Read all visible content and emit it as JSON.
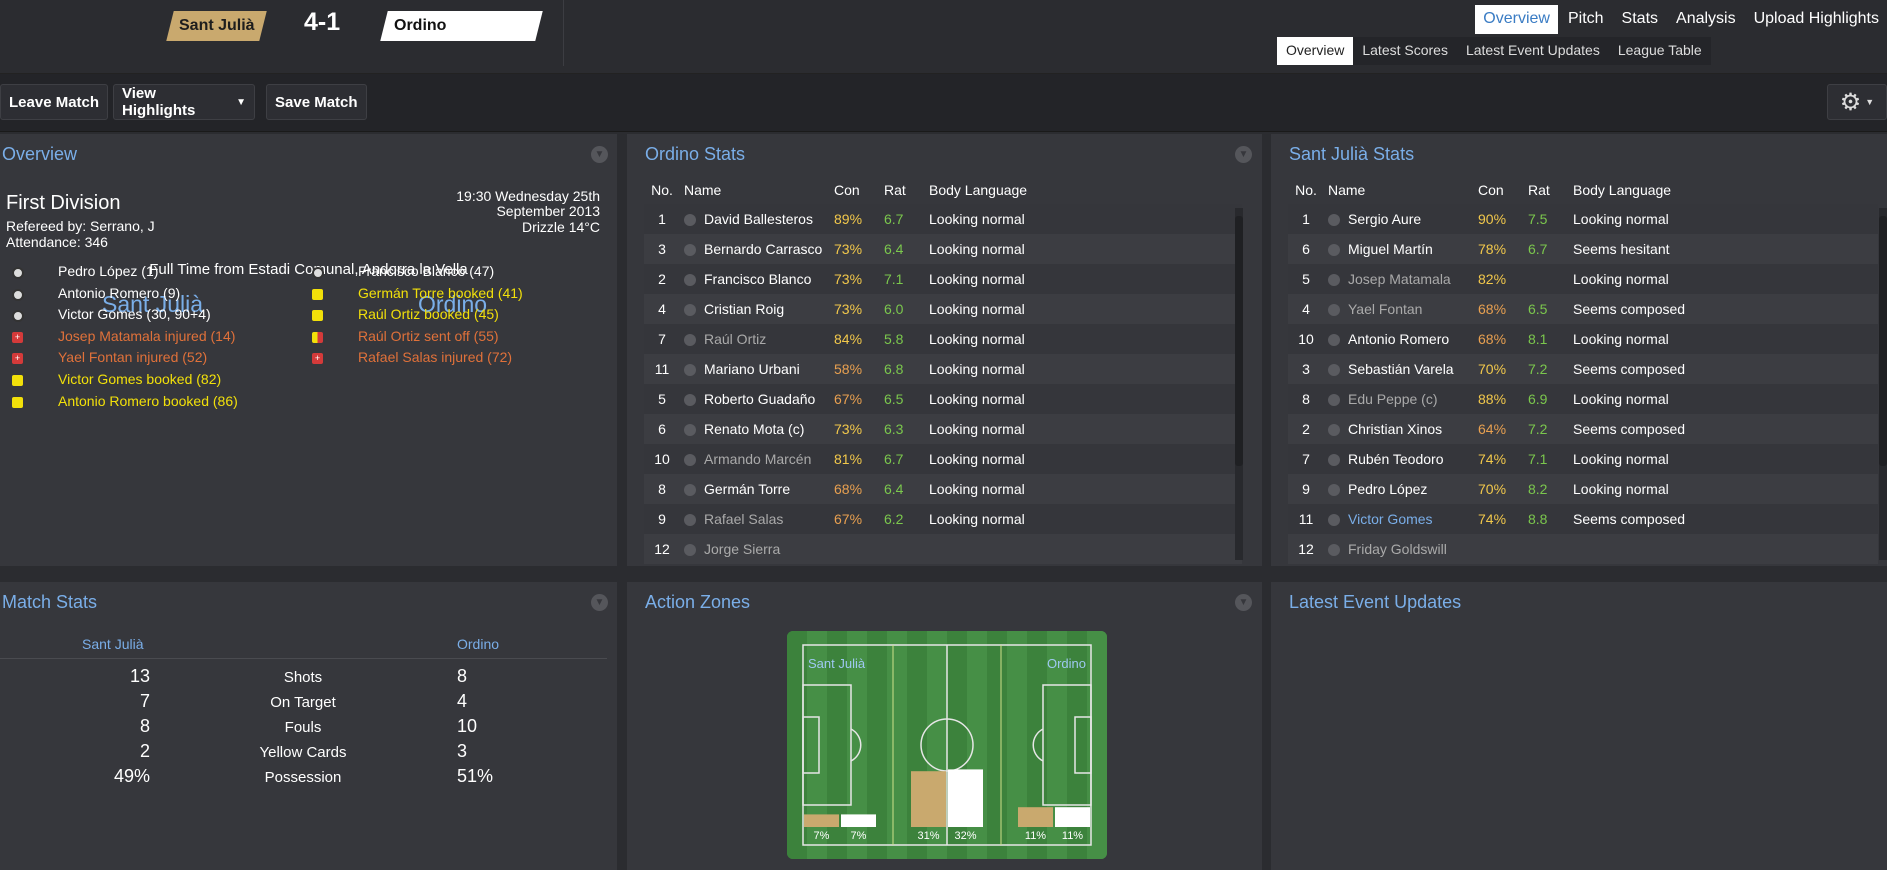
{
  "header": {
    "home": "Sant Julià",
    "score": "4-1",
    "away": "Ordino"
  },
  "nav": {
    "tabs": [
      "Overview",
      "Pitch",
      "Stats",
      "Analysis",
      "Upload Highlights"
    ],
    "subtabs": [
      "Overview",
      "Latest Scores",
      "Latest Event Updates",
      "League Table"
    ]
  },
  "toolbar": {
    "leave": "Leave Match",
    "highlights": "View Highlights",
    "save": "Save Match"
  },
  "overview": {
    "title": "Overview",
    "competition": "First Division",
    "referee": "Refereed by: Serrano, J",
    "attendance": "Attendance: 346",
    "datetime": "19:30 Wednesday 25th September 2013",
    "weather": "Drizzle 14°C",
    "status": "Full Time from Estadi Comunal, Andorra la Vella",
    "home": "Sant Julià",
    "away": "Ordino",
    "home_events": [
      {
        "t": "Pedro López (1)",
        "k": "goal"
      },
      {
        "t": "Antonio Romero (9)",
        "k": "goal"
      },
      {
        "t": "Victor Gomes (30, 90+4)",
        "k": "goal"
      },
      {
        "t": "Josep Matamala injured (14)",
        "k": "injury"
      },
      {
        "t": "Yael Fontan injured (52)",
        "k": "injury"
      },
      {
        "t": "Victor Gomes booked (82)",
        "k": "yellow"
      },
      {
        "t": "Antonio Romero booked (86)",
        "k": "yellow"
      }
    ],
    "away_events": [
      {
        "t": "Francisco Blanco (47)",
        "k": "goal"
      },
      {
        "t": "Germán Torre booked (41)",
        "k": "yellow"
      },
      {
        "t": "Raúl Ortiz booked (45)",
        "k": "yellow"
      },
      {
        "t": "Raúl Ortiz sent off (55)",
        "k": "red"
      },
      {
        "t": "Rafael Salas injured (72)",
        "k": "injury"
      }
    ]
  },
  "ordino": {
    "title": "Ordino Stats",
    "cols": [
      "No.",
      "Name",
      "Con",
      "Rat",
      "Body Language"
    ],
    "rows": [
      [
        "1",
        "David Ballesteros",
        "89%",
        "6.7",
        "Looking normal"
      ],
      [
        "3",
        "Bernardo Carrasco",
        "73%",
        "6.4",
        "Looking normal"
      ],
      [
        "2",
        "Francisco Blanco",
        "73%",
        "7.1",
        "Looking normal"
      ],
      [
        "4",
        "Cristian Roig",
        "73%",
        "6.0",
        "Looking normal"
      ],
      [
        "7",
        "Raúl Ortiz",
        "84%",
        "5.8",
        "Looking normal"
      ],
      [
        "11",
        "Mariano Urbani",
        "58%",
        "6.8",
        "Looking normal"
      ],
      [
        "5",
        "Roberto Guadaño",
        "67%",
        "6.5",
        "Looking normal"
      ],
      [
        "6",
        "Renato Mota (c)",
        "73%",
        "6.3",
        "Looking normal"
      ],
      [
        "10",
        "Armando Marcén",
        "81%",
        "6.7",
        "Looking normal"
      ],
      [
        "8",
        "Germán Torre",
        "68%",
        "6.4",
        "Looking normal"
      ],
      [
        "9",
        "Rafael Salas",
        "67%",
        "6.2",
        "Looking normal"
      ],
      [
        "12",
        "Jorge Sierra",
        "",
        "",
        ""
      ]
    ]
  },
  "santjulia": {
    "title": "Sant Julià Stats",
    "cols": [
      "No.",
      "Name",
      "Con",
      "Rat",
      "Body Language"
    ],
    "rows": [
      [
        "1",
        "Sergio Aure",
        "90%",
        "7.5",
        "Looking normal"
      ],
      [
        "6",
        "Miguel Martín",
        "78%",
        "6.7",
        "Seems hesitant"
      ],
      [
        "5",
        "Josep Matamala",
        "82%",
        "",
        "Looking normal"
      ],
      [
        "4",
        "Yael Fontan",
        "68%",
        "6.5",
        "Seems composed"
      ],
      [
        "10",
        "Antonio Romero",
        "68%",
        "8.1",
        "Looking normal"
      ],
      [
        "3",
        "Sebastián Varela",
        "70%",
        "7.2",
        "Seems composed"
      ],
      [
        "8",
        "Edu Peppe (c)",
        "88%",
        "6.9",
        "Looking normal"
      ],
      [
        "2",
        "Christian Xinos",
        "64%",
        "7.2",
        "Seems composed"
      ],
      [
        "7",
        "Rubén Teodoro",
        "74%",
        "7.1",
        "Looking normal"
      ],
      [
        "9",
        "Pedro López",
        "70%",
        "8.2",
        "Looking normal"
      ],
      [
        "11",
        "Victor Gomes",
        "74%",
        "8.8",
        "Seems composed"
      ],
      [
        "12",
        "Friday Goldswill",
        "",
        "",
        ""
      ]
    ]
  },
  "matchstats": {
    "title": "Match Stats",
    "home": "Sant Julià",
    "away": "Ordino",
    "rows": [
      [
        "13",
        "Shots",
        "8"
      ],
      [
        "7",
        "On Target",
        "4"
      ],
      [
        "8",
        "Fouls",
        "10"
      ],
      [
        "2",
        "Yellow Cards",
        "3"
      ],
      [
        "49%",
        "Possession",
        "51%"
      ]
    ]
  },
  "actionzones": {
    "title": "Action Zones",
    "home": "Sant Julià",
    "away": "Ordino",
    "zones": [
      {
        "home": 7,
        "away": 7,
        "hl": "7%",
        "al": "7%"
      },
      {
        "home": 31,
        "away": 32,
        "hl": "31%",
        "al": "32%"
      },
      {
        "home": 11,
        "away": 11,
        "hl": "11%",
        "al": "11%"
      }
    ],
    "home_color": "#c9a96e",
    "away_color": "#ffffff"
  },
  "events": {
    "title": "Latest Event Updates"
  }
}
